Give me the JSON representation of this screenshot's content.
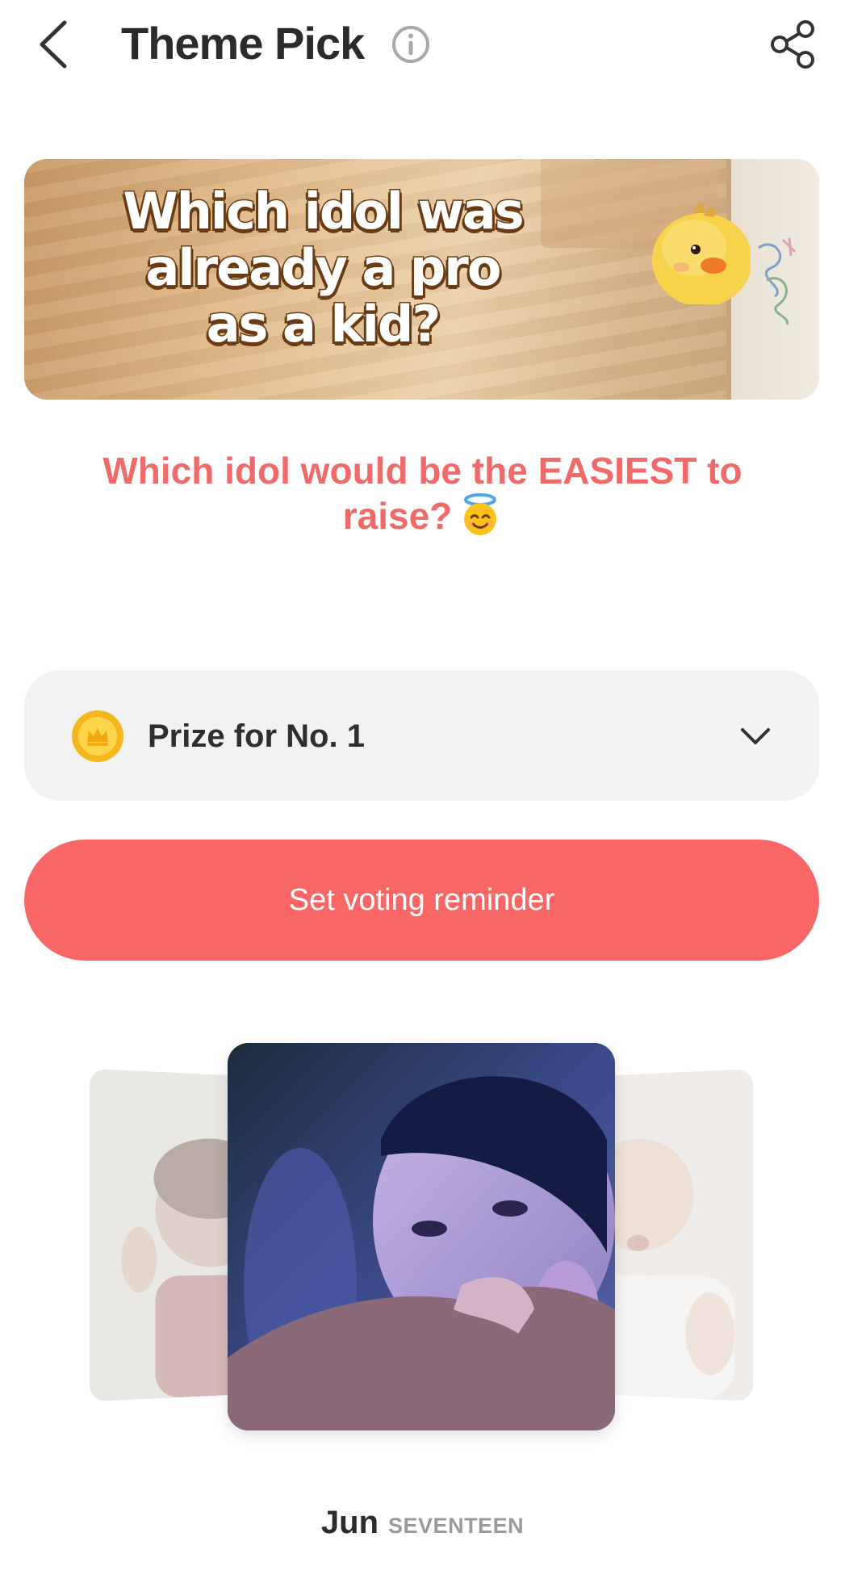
{
  "header": {
    "title": "Theme Pick",
    "back_icon": "chevron-left-icon",
    "info_icon": "info-icon",
    "share_icon": "share-icon"
  },
  "banner": {
    "text": "Which idol was\nalready a pro\nas a kid?"
  },
  "question": {
    "text": "Which idol would be the EASIEST to raise?",
    "emoji": "smiling-face-with-halo",
    "color": "#f06a6a"
  },
  "prize": {
    "label": "Prize for No. 1",
    "icon": "coin-icon",
    "expand_icon": "chevron-down-icon"
  },
  "reminder": {
    "label": "Set voting reminder",
    "color": "#f96666"
  },
  "carousel": {
    "current": {
      "name": "Jun",
      "group": "SEVENTEEN"
    }
  }
}
